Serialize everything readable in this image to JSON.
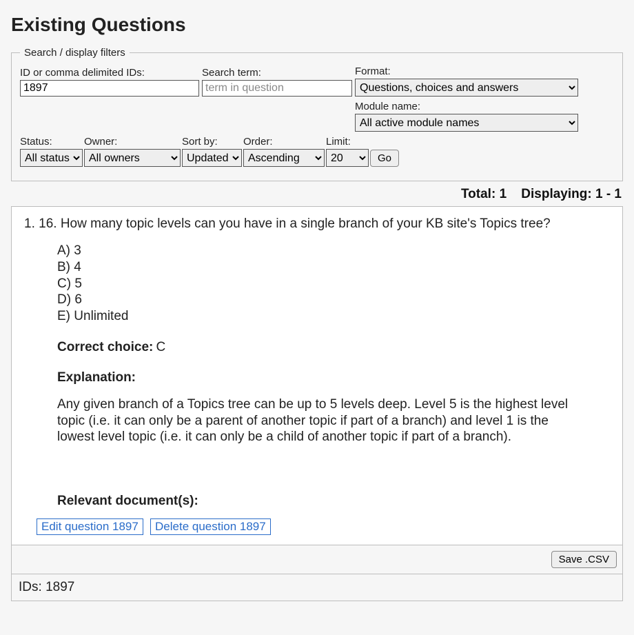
{
  "page": {
    "title": "Existing Questions"
  },
  "filters": {
    "legend": "Search / display filters",
    "id_label": "ID or comma delimited IDs:",
    "id_value": "1897",
    "term_label": "Search term:",
    "term_placeholder": "term in question",
    "term_value": "",
    "format_label": "Format:",
    "format_value": "Questions, choices and answers",
    "module_label": "Module name:",
    "module_value": "All active module names",
    "status_label": "Status:",
    "status_value": "All status",
    "owner_label": "Owner:",
    "owner_value": "All owners",
    "sort_label": "Sort by:",
    "sort_value": "Updated",
    "order_label": "Order:",
    "order_value": "Ascending",
    "limit_label": "Limit:",
    "limit_value": "20",
    "go": "Go"
  },
  "totals": {
    "total_label": "Total:",
    "total_value": "1",
    "displaying_label": "Displaying:",
    "displaying_value": "1 - 1"
  },
  "question": {
    "number": "1.",
    "text": "16. How many topic levels can you have in a single branch of your KB site's Topics tree?",
    "choices": [
      "A) 3",
      "B) 4",
      "C) 5",
      "D) 6",
      "E) Unlimited"
    ],
    "correct_label": "Correct choice:",
    "correct_value": "C",
    "explanation_label": "Explanation:",
    "explanation_text": "Any given branch of a Topics tree can be up to 5 levels deep. Level 5 is the highest level topic (i.e. it can only be a parent of another topic if part of a branch) and level 1 is the lowest level topic (i.e. it can only be a child of another topic if part of a branch).",
    "relevant_docs_label": "Relevant document(s):",
    "edit_label": "Edit question 1897",
    "delete_label": "Delete question 1897"
  },
  "footer": {
    "save_csv": "Save .CSV",
    "ids_label": "IDs:",
    "ids_value": "1897"
  }
}
